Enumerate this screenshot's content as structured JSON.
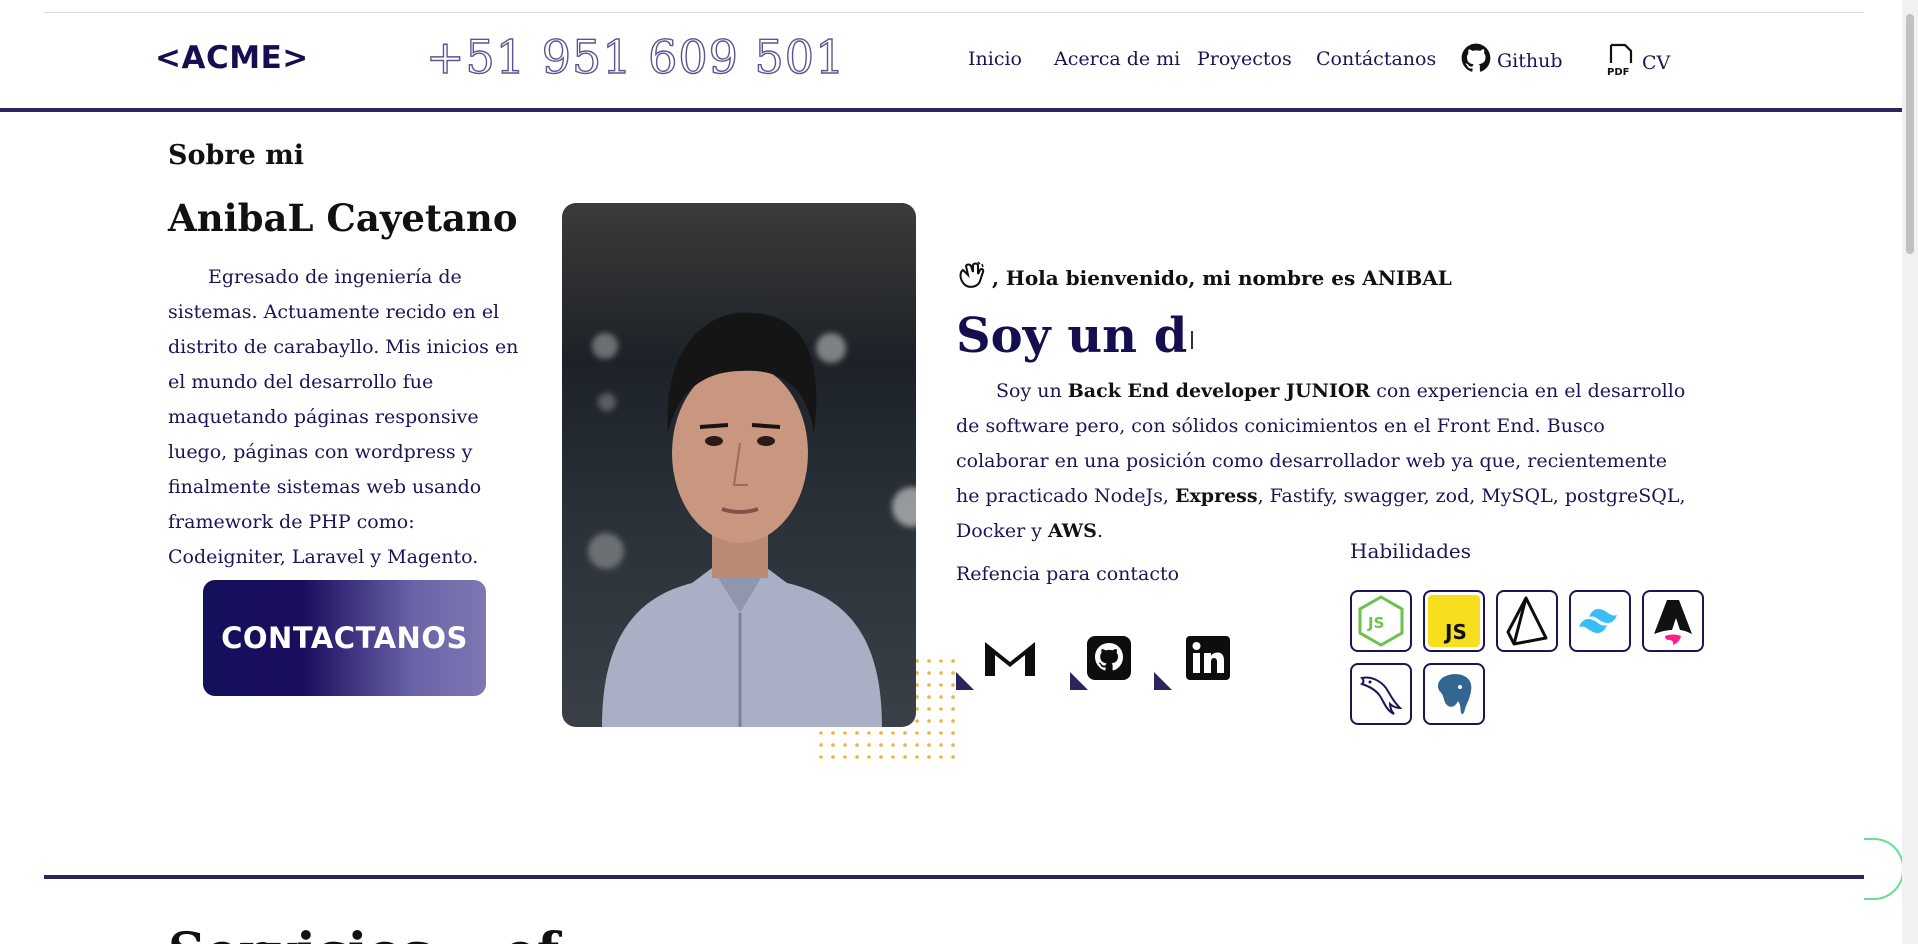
{
  "header": {
    "logo": "<ACME>",
    "phone": "+51 951 609 501",
    "nav": [
      {
        "label": "Inicio"
      },
      {
        "label": "Acerca de mi"
      },
      {
        "label": "Proyectos"
      },
      {
        "label": "Contáctanos"
      }
    ],
    "github_label": "Github",
    "cv_label": "CV"
  },
  "about": {
    "section_label": "Sobre mi",
    "name": "AnibaL Cayetano",
    "bio": "Egresado de ingeniería de sistemas. Actuamente recido en el distrito de carabayllo. Mis inicios en el mundo del desarrollo fue maquetando páginas responsive luego, páginas con wordpress y finalmente sistemas web usando framework de PHP como: Codeigniter, Laravel y Magento.",
    "contact_button": "CONTACTANOS"
  },
  "intro": {
    "greeting": ", Hola bienvenido, mi nombre es ANIBAL",
    "typed_text": "Soy un d",
    "desc_1": "Soy un ",
    "desc_bold_1": "Back End developer JUNIOR",
    "desc_2": " con experiencia en el desarrollo de software pero, con sólidos conicimientos en el Front End. Busco colaborar en una posición como desarrollador web ya que, recientemente he practicado NodeJs, ",
    "desc_bold_2": "Express",
    "desc_3": ", Fastify, swagger, zod, MySQL, postgreSQL, Docker y ",
    "desc_bold_3": "AWS",
    "desc_4": "."
  },
  "contact_ref": {
    "label": "Refencia para contacto",
    "icons": [
      "gmail-icon",
      "github-icon",
      "linkedin-icon"
    ]
  },
  "skills": {
    "label": "Habilidades",
    "icons": [
      "nodejs-icon",
      "javascript-icon",
      "prisma-icon",
      "tailwind-icon",
      "astro-icon",
      "mysql-icon",
      "postgresql-icon"
    ]
  },
  "next_section": {
    "title": "Servicios ...ef"
  }
}
